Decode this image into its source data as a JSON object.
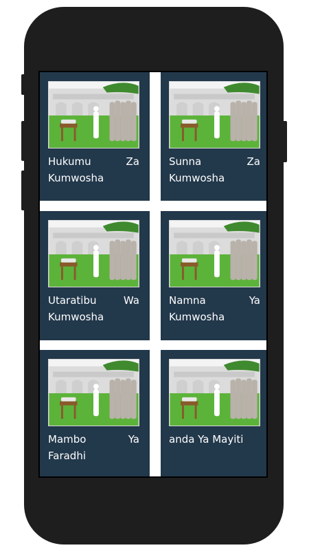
{
  "cards": [
    {
      "title": "Hukumu Za Kumwosha",
      "thumbnail": "funeral-prayer-illustration"
    },
    {
      "title": "Sunna Za Kumwosha",
      "thumbnail": "funeral-prayer-illustration"
    },
    {
      "title": "Utaratibu Wa Kumwosha",
      "thumbnail": "funeral-prayer-illustration"
    },
    {
      "title": "Namna Ya Kumwosha",
      "thumbnail": "funeral-prayer-illustration"
    },
    {
      "title": "Mambo Ya Faradhi",
      "thumbnail": "funeral-prayer-illustration"
    },
    {
      "title": "anda Ya Mayiti",
      "thumbnail": "funeral-prayer-illustration"
    }
  ],
  "colors": {
    "card_bg": "#22384b",
    "screen_bg": "#ffffff",
    "phone_frame": "#1e1e1e",
    "grass": "#5cb33a"
  }
}
